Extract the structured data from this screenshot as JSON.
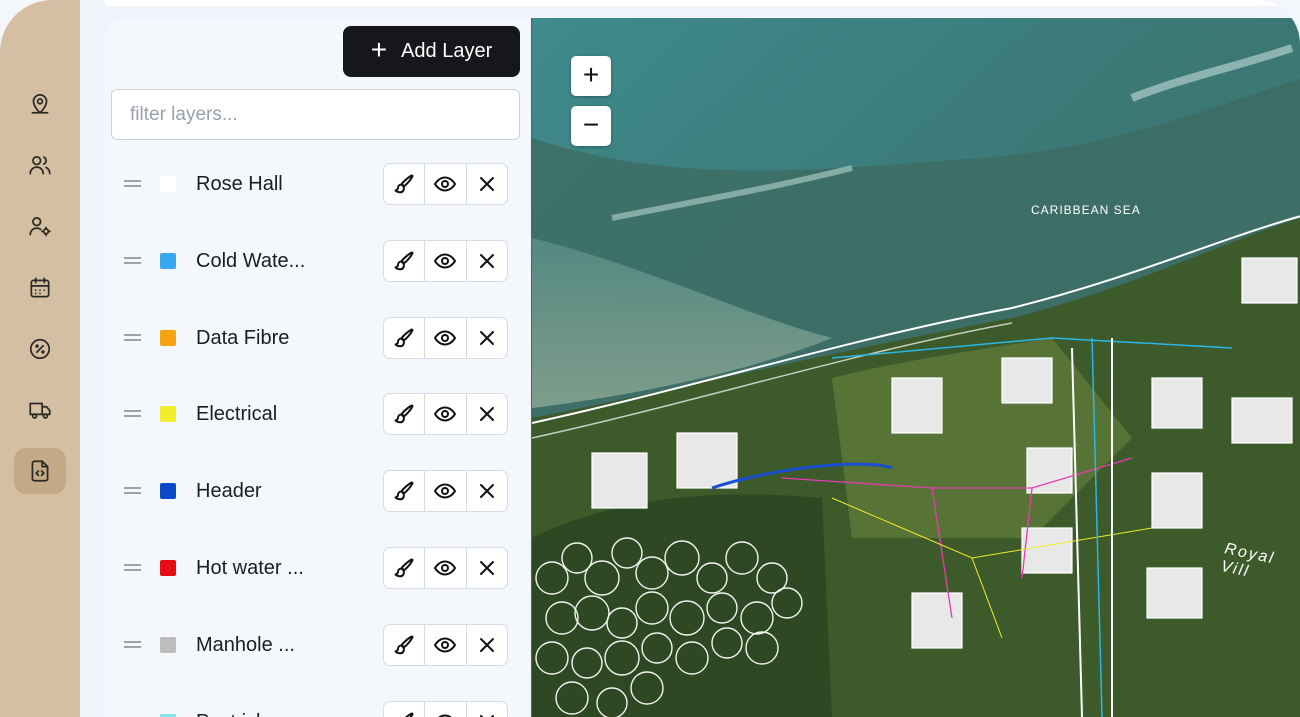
{
  "sidebar": {
    "items": [
      {
        "icon": "map-pin-icon",
        "active": false
      },
      {
        "icon": "users-icon",
        "active": false
      },
      {
        "icon": "user-settings-icon",
        "active": false
      },
      {
        "icon": "calendar-icon",
        "active": false
      },
      {
        "icon": "discount-badge-icon",
        "active": false
      },
      {
        "icon": "truck-icon",
        "active": false
      },
      {
        "icon": "code-file-icon",
        "active": true
      }
    ]
  },
  "panel": {
    "add_layer_label": "Add Layer",
    "filter_placeholder": "filter layers...",
    "layers": [
      {
        "name": "Rose Hall",
        "color": "#ffffff"
      },
      {
        "name": "Cold Wate...",
        "color": "#3aa8f0"
      },
      {
        "name": "Data Fibre",
        "color": "#f5a40f"
      },
      {
        "name": "Electrical",
        "color": "#f2ec2a"
      },
      {
        "name": "Header",
        "color": "#0a48c8"
      },
      {
        "name": "Hot water ...",
        "color": "#e60d14"
      },
      {
        "name": "Manhole ...",
        "color": "#bdbdbd"
      },
      {
        "name": "Pest ick...",
        "color": "#7fe3ea"
      }
    ]
  },
  "map": {
    "zoom_in": "+",
    "zoom_out": "−",
    "labels": {
      "sea": "CARIBBEAN SEA",
      "street": "Royal Vill"
    }
  }
}
